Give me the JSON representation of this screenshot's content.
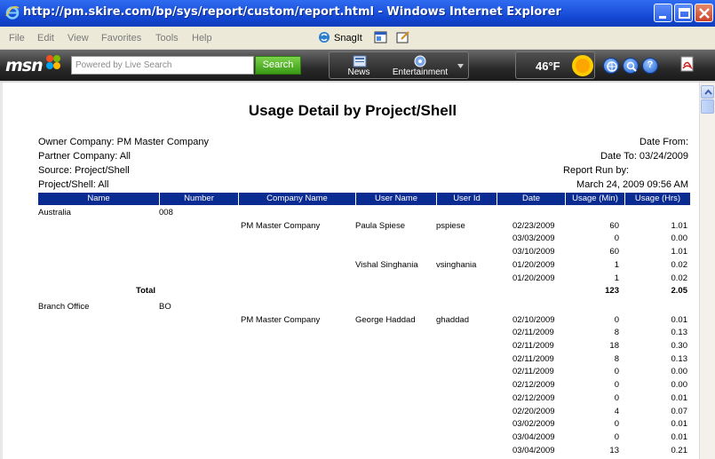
{
  "window": {
    "title": "http://pm.skire.com/bp/sys/report/custom/report.html - Windows Internet Explorer"
  },
  "menu": {
    "items": [
      "File",
      "Edit",
      "View",
      "Favorites",
      "Tools",
      "Help"
    ],
    "snagit_label": "SnagIt"
  },
  "msn_toolbar": {
    "logo": "msn",
    "search_placeholder": "Powered by Live Search",
    "search_button": "Search",
    "tools": [
      "News",
      "Entertainment"
    ],
    "temperature": "46°F"
  },
  "report": {
    "title": "Usage Detail by Project/Shell",
    "left_meta": [
      "Owner Company: PM Master Company",
      "Partner Company: All",
      "Source: Project/Shell",
      "Project/Shell: All"
    ],
    "right_meta": [
      "Date From:",
      "Date To: 03/24/2009",
      "Report Run by:",
      "March 24, 2009 09:56 AM"
    ],
    "columns": [
      "Name",
      "Number",
      "Company Name",
      "User Name",
      "User Id",
      "Date",
      "Usage (Min)",
      "Usage (Hrs)"
    ],
    "groups": [
      {
        "name": "Australia",
        "number": "008",
        "users": [
          {
            "company": "PM Master Company",
            "user_name": "Paula Spiese",
            "user_id": "pspiese",
            "rows": [
              {
                "date": "02/23/2009",
                "min": "60",
                "hrs": "1.01"
              },
              {
                "date": "03/03/2009",
                "min": "0",
                "hrs": "0.00"
              },
              {
                "date": "03/10/2009",
                "min": "60",
                "hrs": "1.01"
              }
            ]
          },
          {
            "company": "",
            "user_name": "Vishal Singhania",
            "user_id": "vsinghania",
            "rows": [
              {
                "date": "01/20/2009",
                "min": "1",
                "hrs": "0.02"
              },
              {
                "date": "01/20/2009",
                "min": "1",
                "hrs": "0.02"
              }
            ]
          }
        ],
        "total_label": "Total",
        "total_min": "123",
        "total_hrs": "2.05"
      },
      {
        "name": "Branch Office",
        "number": "BO",
        "users": [
          {
            "company": "PM Master Company",
            "user_name": "George Haddad",
            "user_id": "ghaddad",
            "rows": [
              {
                "date": "02/10/2009",
                "min": "0",
                "hrs": "0.01"
              },
              {
                "date": "02/11/2009",
                "min": "8",
                "hrs": "0.13"
              },
              {
                "date": "02/11/2009",
                "min": "18",
                "hrs": "0.30"
              },
              {
                "date": "02/11/2009",
                "min": "8",
                "hrs": "0.13"
              },
              {
                "date": "02/11/2009",
                "min": "0",
                "hrs": "0.00"
              },
              {
                "date": "02/12/2009",
                "min": "0",
                "hrs": "0.00"
              },
              {
                "date": "02/12/2009",
                "min": "0",
                "hrs": "0.01"
              },
              {
                "date": "02/20/2009",
                "min": "4",
                "hrs": "0.07"
              },
              {
                "date": "03/02/2009",
                "min": "0",
                "hrs": "0.01"
              },
              {
                "date": "03/04/2009",
                "min": "0",
                "hrs": "0.01"
              },
              {
                "date": "03/04/2009",
                "min": "13",
                "hrs": "0.21"
              }
            ]
          }
        ]
      }
    ]
  }
}
